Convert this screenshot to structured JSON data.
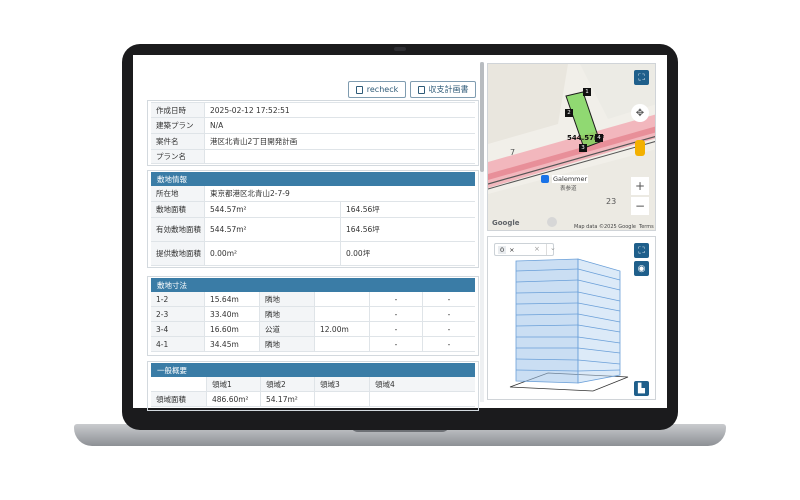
{
  "toolbar": {
    "recheck_label": "recheck",
    "budget_label": "収支計画書"
  },
  "info": {
    "rows": [
      {
        "label": "作成日時",
        "value": "2025-02-12 17:52:51"
      },
      {
        "label": "建築プラン",
        "value": "N/A"
      },
      {
        "label": "案件名",
        "value": "港区北青山2丁目開発計画"
      },
      {
        "label": "プラン名",
        "value": ""
      }
    ]
  },
  "site": {
    "title": "敷地情報",
    "address_label": "所在地",
    "address": "東京都港区北青山2-7-9",
    "area_label": "敷地面積",
    "area_m2": "544.57m²",
    "area_tsubo": "164.56坪",
    "eff_label": "有効敷地面積",
    "eff_m2": "544.57m²",
    "eff_tsubo": "164.56坪",
    "prov_label": "提供敷地面積",
    "prov_m2": "0.00m²",
    "prov_tsubo": "0.00坪"
  },
  "dims": {
    "title": "敷地寸法",
    "rows": [
      {
        "edge": "1-2",
        "len": "15.64m",
        "type": "隣地",
        "width": "",
        "c5": "-",
        "c6": "-"
      },
      {
        "edge": "2-3",
        "len": "33.40m",
        "type": "隣地",
        "width": "",
        "c5": "-",
        "c6": "-"
      },
      {
        "edge": "3-4",
        "len": "16.60m",
        "type": "公道",
        "width": "12.00m",
        "c5": "-",
        "c6": "-"
      },
      {
        "edge": "4-1",
        "len": "34.45m",
        "type": "隣地",
        "width": "",
        "c5": "-",
        "c6": "-"
      }
    ]
  },
  "general": {
    "title": "一般概要",
    "regions": [
      "領域1",
      "領域2",
      "領域3",
      "領域4"
    ],
    "area_label": "領域面積",
    "area_values": [
      "486.60m²",
      "54.17m²"
    ]
  },
  "map": {
    "area_label": "544.57m²",
    "block_7": "7",
    "block_23": "23",
    "station_name": "Galemmer",
    "station_sub": "表参道",
    "attribution": "Map data ©2025 Google",
    "terms": "Terms",
    "google": "Google",
    "points": [
      "1",
      "2",
      "3",
      "4"
    ],
    "zoom_in": "+",
    "zoom_out": "−"
  },
  "viewer": {
    "chip_value": "0",
    "chip_close": "×",
    "clear": "×"
  },
  "colors": {
    "accent": "#1f5f8b",
    "section": "#3a7ca6",
    "parcel": "#6fd14a"
  }
}
